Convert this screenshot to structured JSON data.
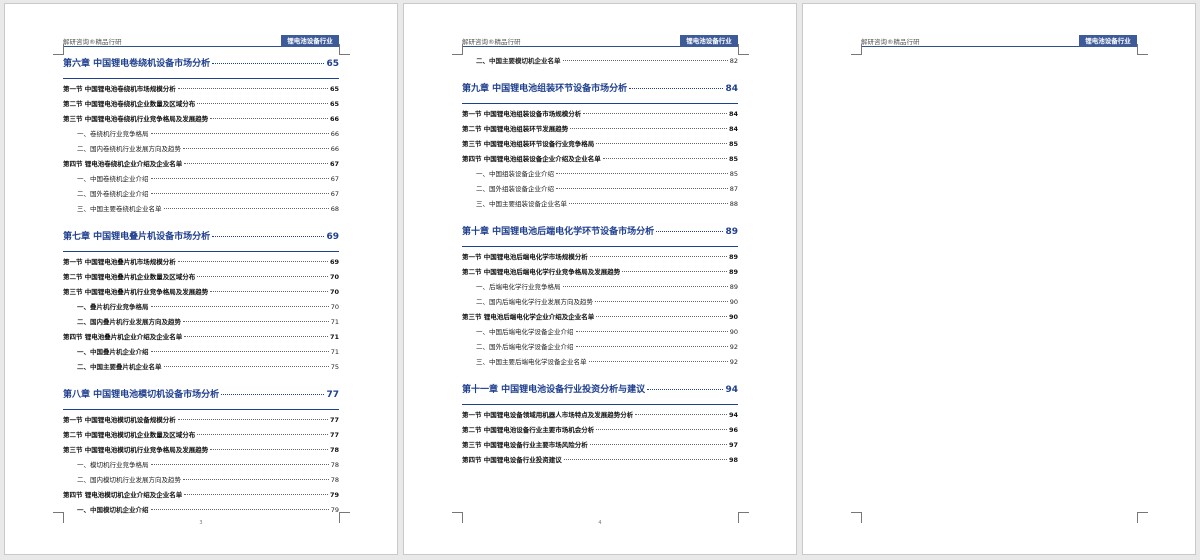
{
  "header": {
    "left": "解研咨询®精品行研",
    "badge": "锂电池设备行业"
  },
  "pages": [
    {
      "page_number": "3",
      "entries": [
        {
          "level": "chapter",
          "title": "第六章  中国锂电卷绕机设备市场分析",
          "page": "65"
        },
        {
          "level": "section",
          "title": "第一节  中国锂电池卷绕机市场规模分析",
          "page": "65"
        },
        {
          "level": "section",
          "title": "第二节  中国锂电池卷绕机企业数量及区域分布",
          "page": "65"
        },
        {
          "level": "section",
          "title": "第三节  中国锂电池卷绕机行业竞争格局及发展趋势",
          "page": "66"
        },
        {
          "level": "item",
          "title": "一、卷绕机行业竞争格局",
          "page": "66"
        },
        {
          "level": "item",
          "title": "二、国内卷绕机行业发展方向及趋势",
          "page": "66"
        },
        {
          "level": "section",
          "title": "第四节  锂电池卷绕机企业介绍及企业名单",
          "page": "67"
        },
        {
          "level": "item",
          "title": "一、中国卷绕机企业介绍",
          "page": "67"
        },
        {
          "level": "item",
          "title": "二、国外卷绕机企业介绍",
          "page": "67"
        },
        {
          "level": "item",
          "title": "三、中国主要卷绕机企业名单",
          "page": "68"
        },
        {
          "level": "chapter",
          "title": "第七章  中国锂电叠片机设备市场分析",
          "page": "69"
        },
        {
          "level": "section",
          "title": "第一节  中国锂电池叠片机市场规模分析",
          "page": "69"
        },
        {
          "level": "section",
          "title": "第二节  中国锂电池叠片机企业数量及区域分布",
          "page": "70"
        },
        {
          "level": "section",
          "title": "第三节  中国锂电池叠片机行业竞争格局及发展趋势",
          "page": "70"
        },
        {
          "level": "item-bold",
          "title": "一、叠片机行业竞争格局",
          "page": "70"
        },
        {
          "level": "item-bold",
          "title": "二、国内叠片机行业发展方向及趋势",
          "page": "71"
        },
        {
          "level": "section",
          "title": "第四节  锂电池叠片机企业介绍及企业名单",
          "page": "71"
        },
        {
          "level": "item-bold",
          "title": "一、中国叠片机企业介绍",
          "page": "71"
        },
        {
          "level": "item-bold",
          "title": "二、中国主要叠片机企业名单",
          "page": "75"
        },
        {
          "level": "chapter",
          "title": "第八章  中国锂电池模切机设备市场分析",
          "page": "77"
        },
        {
          "level": "section",
          "title": "第一节  中国锂电池模切机设备规模分析",
          "page": "77"
        },
        {
          "level": "section",
          "title": "第二节  中国锂电池模切机企业数量及区域分布",
          "page": "77"
        },
        {
          "level": "section",
          "title": "第三节  中国锂电池模切机行业竞争格局及发展趋势",
          "page": "78"
        },
        {
          "level": "item",
          "title": "一、模切机行业竞争格局",
          "page": "78"
        },
        {
          "level": "item",
          "title": "二、国内模切机行业发展方向及趋势",
          "page": "78"
        },
        {
          "level": "section",
          "title": "第四节  锂电池模切机企业介绍及企业名单",
          "page": "79"
        },
        {
          "level": "item-bold",
          "title": "一、中国模切机企业介绍",
          "page": "79"
        }
      ]
    },
    {
      "page_number": "4",
      "entries": [
        {
          "level": "item-bold",
          "title": "二、中国主要模切机企业名单",
          "page": "82"
        },
        {
          "level": "chapter",
          "title": "第九章  中国锂电池组装环节设备市场分析",
          "page": "84"
        },
        {
          "level": "section",
          "title": "第一节  中国锂电池组装设备市场规模分析",
          "page": "84"
        },
        {
          "level": "section",
          "title": "第二节  中国锂电池组装环节发展趋势",
          "page": "84"
        },
        {
          "level": "section",
          "title": "第三节  中国锂电池组装环节设备行业竞争格局",
          "page": "85"
        },
        {
          "level": "section",
          "title": "第四节  中国锂电池组装设备企业介绍及企业名单",
          "page": "85"
        },
        {
          "level": "item",
          "title": "一、中国组装设备企业介绍",
          "page": "85"
        },
        {
          "level": "item",
          "title": "二、国外组装设备企业介绍",
          "page": "87"
        },
        {
          "level": "item",
          "title": "三、中国主要组装设备企业名单",
          "page": "88"
        },
        {
          "level": "chapter",
          "title": "第十章  中国锂电池后端电化学环节设备市场分析",
          "page": "89"
        },
        {
          "level": "section",
          "title": "第一节  中国锂电池后端电化学市场规模分析",
          "page": "89"
        },
        {
          "level": "section",
          "title": "第二节  中国锂电池后端电化学行业竞争格局及发展趋势",
          "page": "89"
        },
        {
          "level": "item",
          "title": "一、后端电化学行业竞争格局",
          "page": "89"
        },
        {
          "level": "item",
          "title": "二、国内后端电化学行业发展方向及趋势",
          "page": "90"
        },
        {
          "level": "section",
          "title": "第三节  锂电池后端电化学企业介绍及企业名单",
          "page": "90"
        },
        {
          "level": "item",
          "title": "一、中国后端电化学设备企业介绍",
          "page": "90"
        },
        {
          "level": "item",
          "title": "二、国外后端电化学设备企业介绍",
          "page": "92"
        },
        {
          "level": "item",
          "title": "三、中国主要后端电化学设备企业名单",
          "page": "92"
        },
        {
          "level": "chapter",
          "title": "第十一章  中国锂电池设备行业投资分析与建议",
          "page": "94"
        },
        {
          "level": "section",
          "title": "第一节  中国锂电设备领域用机器人市场特点及发展趋势分析",
          "page": "94"
        },
        {
          "level": "section",
          "title": "第二节  中国锂电池设备行业主要市场机会分析",
          "page": "96"
        },
        {
          "level": "section",
          "title": "第三节  中国锂电设备行业主要市场风险分析",
          "page": "97"
        },
        {
          "level": "section",
          "title": "第四节  中国锂电设备行业投资建议",
          "page": "98"
        }
      ]
    },
    {
      "page_number": "",
      "entries": []
    }
  ]
}
